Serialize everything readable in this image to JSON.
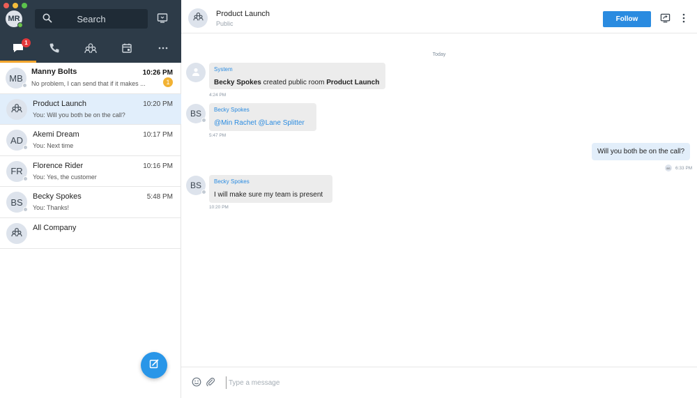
{
  "colors": {
    "sidebar_dark": "#2d3b48",
    "accent": "#2a8be0",
    "tab_active": "#f2a52e",
    "unread_badge": "#e5383b",
    "count_badge": "#f2b233"
  },
  "sidebar": {
    "user_initials": "MR",
    "search_label": "Search",
    "tabs": [
      {
        "icon": "chat-icon",
        "badge": "1",
        "active": true
      },
      {
        "icon": "phone-icon"
      },
      {
        "icon": "team-icon"
      },
      {
        "icon": "calendar-icon"
      },
      {
        "icon": "more-icon"
      }
    ],
    "conversations": [
      {
        "initials": "MB",
        "name": "Manny Bolts",
        "preview": "No problem, I can send that if it makes ...",
        "time": "10:26 PM",
        "unread": "1"
      },
      {
        "initials": "",
        "icon": "team-icon",
        "name": "Product Launch",
        "preview": "You: Will you both be on the call?",
        "time": "10:20 PM"
      },
      {
        "initials": "AD",
        "name": "Akemi Dream",
        "preview": "You: Next time",
        "time": "10:17 PM"
      },
      {
        "initials": "FR",
        "name": "Florence Rider",
        "preview": "You: Yes, the customer",
        "time": "10:16 PM"
      },
      {
        "initials": "BS",
        "name": "Becky Spokes",
        "preview": "You: Thanks!",
        "time": "5:48 PM"
      },
      {
        "initials": "",
        "icon": "team-icon",
        "name": "All Company",
        "preview": "",
        "time": ""
      }
    ]
  },
  "header": {
    "title": "Product Launch",
    "subtitle": "Public",
    "follow_label": "Follow"
  },
  "chat": {
    "day_label": "Today",
    "system_msg": {
      "sender": "System",
      "actor": "Becky Spokes",
      "action": " created public room ",
      "room": "Product Launch",
      "time": "4:24 PM"
    },
    "mention_msg": {
      "initials": "BS",
      "sender": "Becky Spokes",
      "mention1": "@Min Rachet",
      "mention2": "@Lane Splitter",
      "time": "5:47 PM"
    },
    "own_msg": {
      "text": "Will you both be on the call?",
      "reader_initials": "BS",
      "time": "6:33 PM"
    },
    "reply_msg": {
      "initials": "BS",
      "sender": "Becky Spokes",
      "text": "I will make sure my team is present",
      "time": "10:20 PM"
    }
  },
  "composer": {
    "placeholder": "Type a message"
  }
}
